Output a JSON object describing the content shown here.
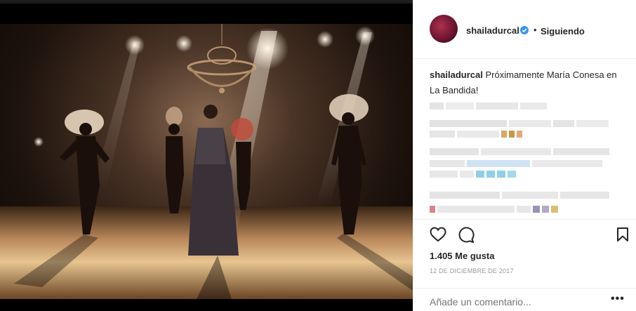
{
  "post": {
    "username": "shailadurcal",
    "follow_status": "Siguiendo",
    "separator": "•",
    "caption_user": "shailadurcal",
    "caption_text": "Próximamente María Conesa en La Bandida!",
    "likes": "1.405 Me gusta",
    "date": "12 DE DICIEMBRE DE 2017",
    "comment_placeholder": "Añade un comentario...",
    "more_label": "•••"
  },
  "icons": {
    "verified": "verified-badge-icon",
    "like": "heart-icon",
    "comment": "comment-bubble-icon",
    "save": "bookmark-icon",
    "more": "more-options-icon"
  },
  "colors": {
    "verified": "#3897f0",
    "text": "#262626",
    "muted": "#999999",
    "divider": "#efefef"
  }
}
